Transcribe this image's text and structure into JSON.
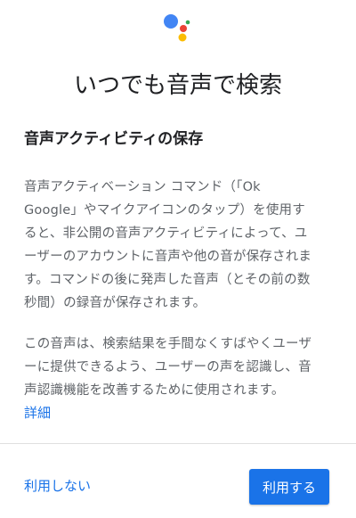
{
  "logo": {
    "name": "google-assistant",
    "colors": {
      "blue": "#4285f4",
      "red": "#ea4335",
      "yellow": "#fbbc04",
      "green": "#34a853"
    }
  },
  "dialog": {
    "title": "いつでも音声で検索",
    "section_title": "音声アクティビティの保存",
    "paragraph1_lines": [
      "音声アクティベーション コマンド（「Ok",
      "Google」やマイクアイコンのタップ）を使用す",
      "ると、非公開の音声アクティビティによって、ユ",
      "ーザーのアカウントに音声や他の音が保存されま",
      "す。コマンドの後に発声した音声（とその前の数",
      "秒間）の録音が保存されます。"
    ],
    "paragraph2_lines": [
      "この音声は、検索結果を手間なくすばやくユーザ",
      "ーに提供できるよう、ユーザーの声を認識し、音",
      "声認識機能を改善するために使用されます。"
    ],
    "details_link": "詳細"
  },
  "actions": {
    "decline_label": "利用しない",
    "accept_label": "利用する"
  },
  "colors": {
    "accent": "#1a73e8",
    "body_text": "#5f6368",
    "title_text": "#202124"
  }
}
